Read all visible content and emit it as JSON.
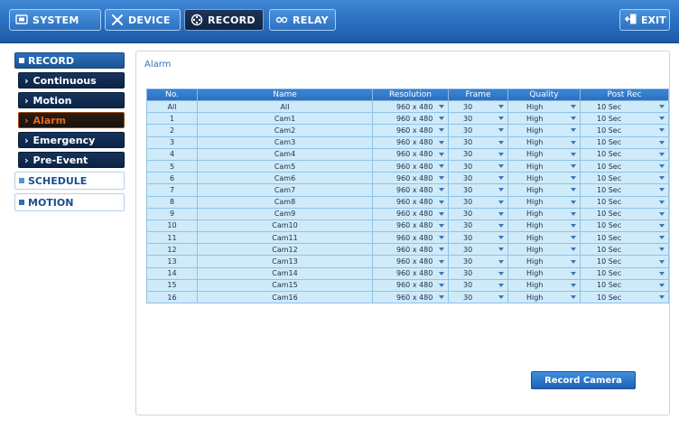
{
  "nav": {
    "tabs": [
      {
        "label": "SYSTEM",
        "icon": "monitor-icon"
      },
      {
        "label": "DEVICE",
        "icon": "tools-icon"
      },
      {
        "label": "RECORD",
        "icon": "film-reel-icon"
      },
      {
        "label": "RELAY",
        "icon": "relay-icon"
      }
    ],
    "active_tab": "RECORD",
    "exit_label": "EXIT"
  },
  "sidebar": {
    "record_label": "RECORD",
    "items": [
      {
        "label": "Continuous"
      },
      {
        "label": "Motion"
      },
      {
        "label": "Alarm"
      },
      {
        "label": "Emergency"
      },
      {
        "label": "Pre-Event"
      }
    ],
    "active_item": "Alarm",
    "schedule_label": "SCHEDULE",
    "motion_label": "MOTION"
  },
  "main": {
    "title": "Alarm",
    "columns": [
      "No.",
      "Name",
      "Resolution",
      "Frame",
      "Quality",
      "Post Rec"
    ],
    "rows": [
      {
        "no": "All",
        "name": "All",
        "resolution": "960 x 480",
        "frame": "30",
        "quality": "High",
        "post": "10 Sec"
      },
      {
        "no": "1",
        "name": "Cam1",
        "resolution": "960 x 480",
        "frame": "30",
        "quality": "High",
        "post": "10 Sec"
      },
      {
        "no": "2",
        "name": "Cam2",
        "resolution": "960 x 480",
        "frame": "30",
        "quality": "High",
        "post": "10 Sec"
      },
      {
        "no": "3",
        "name": "Cam3",
        "resolution": "960 x 480",
        "frame": "30",
        "quality": "High",
        "post": "10 Sec"
      },
      {
        "no": "4",
        "name": "Cam4",
        "resolution": "960 x 480",
        "frame": "30",
        "quality": "High",
        "post": "10 Sec"
      },
      {
        "no": "5",
        "name": "Cam5",
        "resolution": "960 x 480",
        "frame": "30",
        "quality": "High",
        "post": "10 Sec"
      },
      {
        "no": "6",
        "name": "Cam6",
        "resolution": "960 x 480",
        "frame": "30",
        "quality": "High",
        "post": "10 Sec"
      },
      {
        "no": "7",
        "name": "Cam7",
        "resolution": "960 x 480",
        "frame": "30",
        "quality": "High",
        "post": "10 Sec"
      },
      {
        "no": "8",
        "name": "Cam8",
        "resolution": "960 x 480",
        "frame": "30",
        "quality": "High",
        "post": "10 Sec"
      },
      {
        "no": "9",
        "name": "Cam9",
        "resolution": "960 x 480",
        "frame": "30",
        "quality": "High",
        "post": "10 Sec"
      },
      {
        "no": "10",
        "name": "Cam10",
        "resolution": "960 x 480",
        "frame": "30",
        "quality": "High",
        "post": "10 Sec"
      },
      {
        "no": "11",
        "name": "Cam11",
        "resolution": "960 x 480",
        "frame": "30",
        "quality": "High",
        "post": "10 Sec"
      },
      {
        "no": "12",
        "name": "Cam12",
        "resolution": "960 x 480",
        "frame": "30",
        "quality": "High",
        "post": "10 Sec"
      },
      {
        "no": "13",
        "name": "Cam13",
        "resolution": "960 x 480",
        "frame": "30",
        "quality": "High",
        "post": "10 Sec"
      },
      {
        "no": "14",
        "name": "Cam14",
        "resolution": "960 x 480",
        "frame": "30",
        "quality": "High",
        "post": "10 Sec"
      },
      {
        "no": "15",
        "name": "Cam15",
        "resolution": "960 x 480",
        "frame": "30",
        "quality": "High",
        "post": "10 Sec"
      },
      {
        "no": "16",
        "name": "Cam16",
        "resolution": "960 x 480",
        "frame": "30",
        "quality": "High",
        "post": "10 Sec"
      }
    ],
    "record_camera_label": "Record Camera"
  },
  "colors": {
    "accent": "#2a6ebf",
    "header_blue": "#3a86d6",
    "row_bg": "#cfeaf8",
    "active_text": "#e46a1e",
    "dark_nav": "#16345d"
  }
}
